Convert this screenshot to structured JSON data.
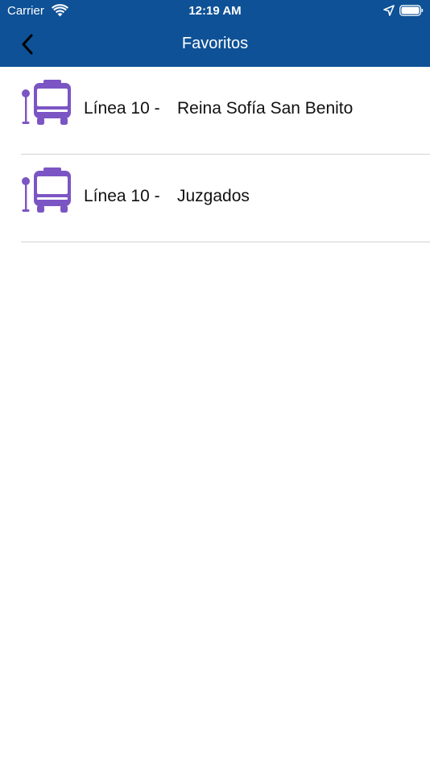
{
  "status_bar": {
    "carrier": "Carrier",
    "time": "12:19 AM",
    "icons": [
      "wifi-icon",
      "location-arrow-icon",
      "battery-icon"
    ]
  },
  "nav": {
    "title": "Favoritos",
    "back_icon": "chevron-left-icon",
    "background_color": "#0e5196"
  },
  "favorites": [
    {
      "line": "Línea 10 -",
      "stop": "Reina Sofía San Benito",
      "icon": "bus-stop-icon"
    },
    {
      "line": "Línea 10 -",
      "stop": "Juzgados",
      "icon": "bus-stop-icon"
    }
  ],
  "colors": {
    "accent": "#7c55c4",
    "separator": "#d3d3d3"
  }
}
